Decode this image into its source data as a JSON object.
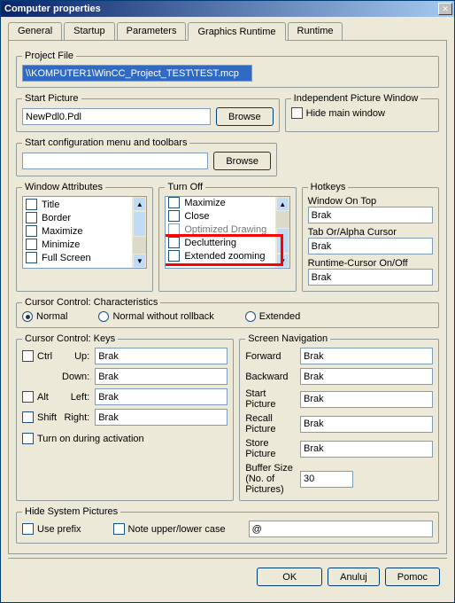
{
  "title": "Computer properties",
  "tabs": [
    "General",
    "Startup",
    "Parameters",
    "Graphics Runtime",
    "Runtime"
  ],
  "activeTab": "Graphics Runtime",
  "projectFile": {
    "legend": "Project File",
    "value": "\\\\KOMPUTER1\\WinCC_Project_TEST\\TEST.mcp"
  },
  "startPicture": {
    "legend": "Start Picture",
    "value": "NewPdl0.Pdl",
    "browse": "Browse"
  },
  "startConfig": {
    "legend": "Start configuration menu and toolbars",
    "value": "",
    "browse": "Browse"
  },
  "ipw": {
    "legend": "Independent Picture Window",
    "hide": "Hide main window"
  },
  "windowAttr": {
    "legend": "Window Attributes",
    "items": [
      "Title",
      "Border",
      "Maximize",
      "Minimize",
      "Full Screen"
    ]
  },
  "turnOff": {
    "legend": "Turn Off",
    "items": [
      "Maximize",
      "Close",
      "Optimized Drawing",
      "Decluttering",
      "Extended zooming"
    ]
  },
  "hotkeys": {
    "legend": "Hotkeys",
    "l1": "Window On Top",
    "v1": "Brak",
    "l2": "Tab Or/Alpha Cursor",
    "v2": "Brak",
    "l3": "Runtime-Cursor On/Off",
    "v3": "Brak"
  },
  "cursorChar": {
    "legend": "Cursor Control: Characteristics",
    "r1": "Normal",
    "r2": "Normal without rollback",
    "r3": "Extended"
  },
  "cursorKeys": {
    "legend": "Cursor Control: Keys",
    "ctrl": "Ctrl",
    "alt": "Alt",
    "shift": "Shift",
    "up": "Up:",
    "down": "Down:",
    "left": "Left:",
    "right": "Right:",
    "brak": "Brak",
    "turnon": "Turn on during activation"
  },
  "screenNav": {
    "legend": "Screen Navigation",
    "fwd": "Forward",
    "bwd": "Backward",
    "sp": "Start Picture",
    "rp": "Recall Picture",
    "stp": "Store Picture",
    "brak": "Brak",
    "bs": "Buffer Size (No. of Pictures)",
    "bsv": "30"
  },
  "hideSys": {
    "legend": "Hide System Pictures",
    "use": "Use prefix",
    "note": "Note upper/lower case",
    "at": "@"
  },
  "buttons": {
    "ok": "OK",
    "cancel": "Anuluj",
    "help": "Pomoc"
  }
}
